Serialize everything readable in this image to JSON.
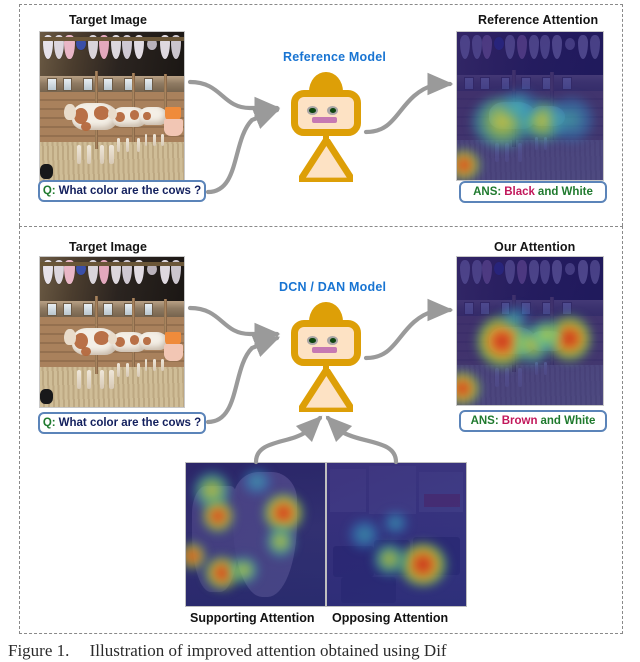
{
  "figure": {
    "caption_label": "Figure 1.",
    "caption_text": "Illustration of improved attention obtained using Dif"
  },
  "panels": [
    {
      "id": "reference",
      "target_heading": "Target Image",
      "attention_heading": "Reference Attention",
      "model_label": "Reference Model",
      "question": {
        "prefix": "Q:",
        "text": "What color are the cows ?"
      },
      "answer": {
        "prefix": "ANS:",
        "highlight": "Black",
        "suffix": "and White"
      }
    },
    {
      "id": "ours",
      "target_heading": "Target Image",
      "attention_heading": "Our Attention",
      "model_label": "DCN / DAN Model",
      "question": {
        "prefix": "Q:",
        "text": "What color are the cows ?"
      },
      "answer": {
        "prefix": "ANS:",
        "highlight": "Brown",
        "suffix": "and White"
      }
    }
  ],
  "evidence": {
    "supporting_label": "Supporting Attention",
    "opposing_label": "Opposing Attention"
  },
  "colors": {
    "model_label": "#1874d2",
    "answer_key": "#1f7a2e",
    "answer_highlight": "#c2185b",
    "question_key": "#1f7a2e",
    "question_text": "#13205e",
    "callout_border": "#5b84b9",
    "robot_body": "#dd9f07",
    "robot_face": "#fde2c4",
    "arrow": "#9a9a9a",
    "panel_border": "#8a8a8a"
  },
  "icons": {
    "robot": "robot-icon",
    "arrow": "arrow-icon"
  }
}
